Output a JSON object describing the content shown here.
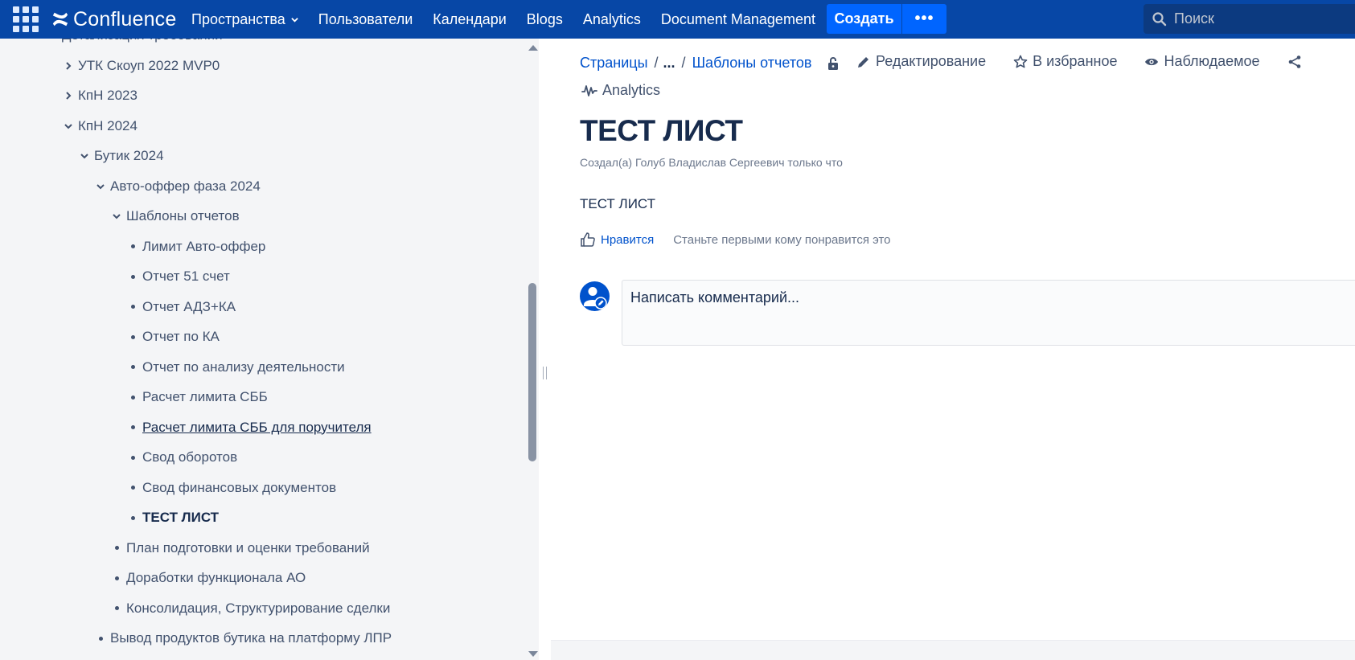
{
  "topnav": {
    "logo_text": "Confluence",
    "items": [
      "Пространства",
      "Пользователи",
      "Календари",
      "Blogs",
      "Analytics",
      "Document Management"
    ],
    "create_label": "Создать",
    "more_label": "•••",
    "search_placeholder": "Поиск",
    "bg_color": "#0747a6",
    "accent_color": "#0065ff"
  },
  "sidebar": {
    "items": [
      {
        "label": "Детализация требований",
        "type": "expanded",
        "depth": 0
      },
      {
        "label": "УТК Скоуп 2022 MVP0",
        "type": "collapsed",
        "depth": 1
      },
      {
        "label": "КпН 2023",
        "type": "collapsed",
        "depth": 1
      },
      {
        "label": "КпН 2024",
        "type": "expanded",
        "depth": 1
      },
      {
        "label": "Бутик 2024",
        "type": "expanded",
        "depth": 2
      },
      {
        "label": "Авто-оффер фаза 2024",
        "type": "expanded",
        "depth": 3
      },
      {
        "label": "Шаблоны отчетов",
        "type": "expanded",
        "depth": 4
      },
      {
        "label": "Лимит Авто-оффер",
        "type": "leaf",
        "depth": 5
      },
      {
        "label": "Отчет 51 счет",
        "type": "leaf",
        "depth": 5
      },
      {
        "label": "Отчет АДЗ+КА",
        "type": "leaf",
        "depth": 5
      },
      {
        "label": "Отчет по КА",
        "type": "leaf",
        "depth": 5
      },
      {
        "label": "Отчет по анализу деятельности",
        "type": "leaf",
        "depth": 5
      },
      {
        "label": "Расчет лимита СББ",
        "type": "leaf",
        "depth": 5
      },
      {
        "label": "Расчет лимита СББ для поручителя",
        "type": "leaf",
        "depth": 5,
        "state": "hover"
      },
      {
        "label": "Свод оборотов",
        "type": "leaf",
        "depth": 5
      },
      {
        "label": "Свод финансовых документов",
        "type": "leaf",
        "depth": 5
      },
      {
        "label": "ТЕСТ ЛИСТ",
        "type": "leaf",
        "depth": 5,
        "state": "current"
      },
      {
        "label": "План подготовки и оценки требований",
        "type": "leaf",
        "depth": 4
      },
      {
        "label": "Доработки функционала АО",
        "type": "leaf",
        "depth": 4
      },
      {
        "label": "Консолидация, Структурирование сделки",
        "type": "leaf",
        "depth": 4
      },
      {
        "label": "Вывод продуктов бутика на платформу ЛПР",
        "type": "leaf",
        "depth": 3
      }
    ]
  },
  "main": {
    "breadcrumbs": {
      "root": "Страницы",
      "separator": "/",
      "ellipsis": "...",
      "parent": "Шаблоны отчетов"
    },
    "actions": {
      "edit": "Редактирование",
      "favorite": "В избранное",
      "watch": "Наблюдаемое"
    },
    "analytics_label": "Analytics",
    "title": "ТЕСТ ЛИСТ",
    "byline": {
      "prefix": "Создал(а)",
      "author": "Голуб Владислав Сергеевич",
      "time": "только что"
    },
    "body_text": "ТЕСТ ЛИСТ",
    "like": {
      "button": "Нравится",
      "text": "Станьте первыми кому понравится это"
    },
    "comment_placeholder": "Написать комментарий..."
  }
}
